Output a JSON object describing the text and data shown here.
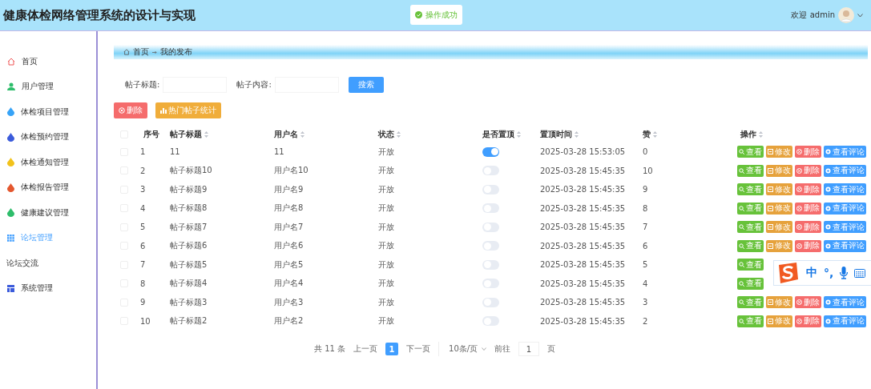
{
  "header": {
    "title": "健康体检网络管理系统的设计与实现",
    "toast": "操作成功",
    "welcome": "欢迎 admin"
  },
  "sidebar": {
    "items": [
      {
        "kind": "home",
        "label": "首页",
        "selected": false
      },
      {
        "kind": "user",
        "label": "用户管理",
        "selected": false
      },
      {
        "kind": "drop",
        "label": "体检项目管理",
        "selected": false,
        "color": "#36a3f7"
      },
      {
        "kind": "drop",
        "label": "体检预约管理",
        "selected": false,
        "color": "#3b5bdb"
      },
      {
        "kind": "drop",
        "label": "体检通知管理",
        "selected": false,
        "color": "#f2c21b"
      },
      {
        "kind": "drop",
        "label": "体检报告管理",
        "selected": false,
        "color": "#e4572e"
      },
      {
        "kind": "drop",
        "label": "健康建议管理",
        "selected": false,
        "color": "#2ebd6b"
      },
      {
        "kind": "grid",
        "label": "论坛管理",
        "selected": true
      },
      {
        "kind": "label",
        "label": "论坛交流",
        "selected": false
      },
      {
        "kind": "table",
        "label": "系统管理",
        "selected": false
      }
    ]
  },
  "breadcrumb": [
    "首页",
    "我的发布"
  ],
  "search": {
    "fields": [
      {
        "label": "帖子标题:"
      },
      {
        "label": "帖子内容:"
      }
    ],
    "button": "搜索"
  },
  "toolbar": [
    {
      "kind": "delete",
      "label": "删除"
    },
    {
      "kind": "chart",
      "label": "热门帖子统计"
    }
  ],
  "table": {
    "select_all": false,
    "columns": [
      "序号",
      "帖子标题",
      "用户名",
      "状态",
      "是否置顶",
      "置顶时间",
      "赞",
      "操作"
    ],
    "rows": [
      {
        "checked": false,
        "cells": [
          "1",
          "11",
          "11",
          "开放"
        ],
        "on": true,
        "time": "2025-03-28 15:53:05",
        "likes": "0",
        "actions": [
          "查看",
          "修改",
          "删除",
          "查看评论"
        ]
      },
      {
        "checked": false,
        "cells": [
          "2",
          "帖子标题10",
          "用户名10",
          "开放"
        ],
        "on": false,
        "time": "2025-03-28 15:45:35",
        "likes": "10",
        "actions": [
          "查看",
          "修改",
          "删除",
          "查看评论"
        ]
      },
      {
        "checked": false,
        "cells": [
          "3",
          "帖子标题9",
          "用户名9",
          "开放"
        ],
        "on": false,
        "time": "2025-03-28 15:45:35",
        "likes": "9",
        "actions": [
          "查看",
          "修改",
          "删除",
          "查看评论"
        ]
      },
      {
        "checked": false,
        "cells": [
          "4",
          "帖子标题8",
          "用户名8",
          "开放"
        ],
        "on": false,
        "time": "2025-03-28 15:45:35",
        "likes": "8",
        "actions": [
          "查看",
          "修改",
          "删除",
          "查看评论"
        ]
      },
      {
        "checked": false,
        "cells": [
          "5",
          "帖子标题7",
          "用户名7",
          "开放"
        ],
        "on": false,
        "time": "2025-03-28 15:45:35",
        "likes": "7",
        "actions": [
          "查看",
          "修改",
          "删除",
          "查看评论"
        ]
      },
      {
        "checked": false,
        "cells": [
          "6",
          "帖子标题6",
          "用户名6",
          "开放"
        ],
        "on": false,
        "time": "2025-03-28 15:45:35",
        "likes": "6",
        "actions": [
          "查看",
          "修改",
          "删除",
          "查看评论"
        ]
      },
      {
        "checked": false,
        "cells": [
          "7",
          "帖子标题5",
          "用户名5",
          "开放"
        ],
        "on": false,
        "time": "2025-03-28 15:45:35",
        "likes": "5",
        "actions": [
          "查看"
        ]
      },
      {
        "checked": false,
        "cells": [
          "8",
          "帖子标题4",
          "用户名4",
          "开放"
        ],
        "on": false,
        "time": "2025-03-28 15:45:35",
        "likes": "4",
        "actions": [
          "查看"
        ]
      },
      {
        "checked": false,
        "cells": [
          "9",
          "帖子标题3",
          "用户名3",
          "开放"
        ],
        "on": false,
        "time": "2025-03-28 15:45:35",
        "likes": "3",
        "actions": [
          "查看",
          "修改",
          "删除",
          "查看评论"
        ]
      },
      {
        "checked": false,
        "cells": [
          "10",
          "帖子标题2",
          "用户名2",
          "开放"
        ],
        "on": false,
        "time": "2025-03-28 15:45:35",
        "likes": "2",
        "actions": [
          "查看",
          "修改",
          "删除",
          "查看评论"
        ]
      }
    ]
  },
  "pagination": {
    "total": "共 11 条",
    "prev": "上一页",
    "pages": [
      {
        "label": "1",
        "selected": true
      }
    ],
    "next": "下一页",
    "page_size": "10条/页",
    "goto": "前往",
    "goto_value": "1",
    "unit": "页"
  },
  "ime": {
    "items": [
      "中",
      "°,"
    ]
  }
}
